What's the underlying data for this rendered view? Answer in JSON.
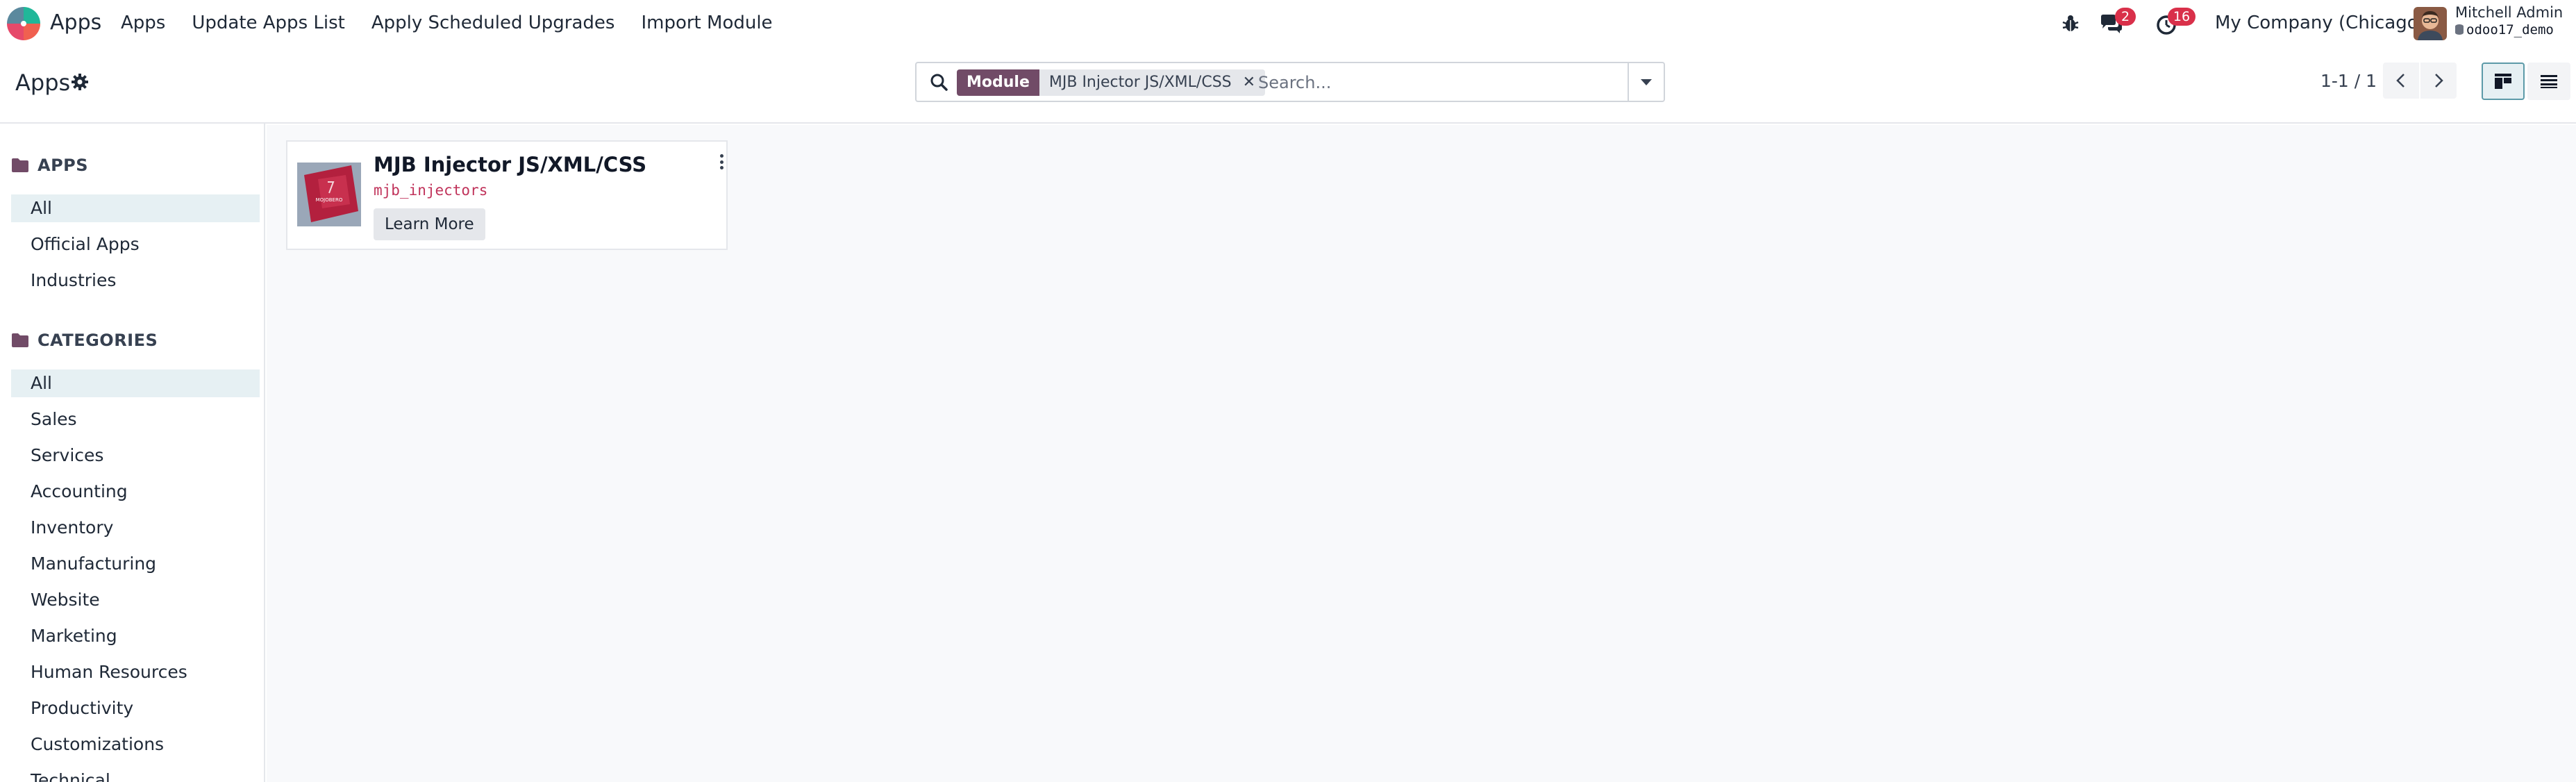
{
  "navbar": {
    "app_name": "Apps",
    "menu": [
      "Apps",
      "Update Apps List",
      "Apply Scheduled Upgrades",
      "Import Module"
    ],
    "messages_count": "2",
    "activities_count": "16",
    "company": "My Company (Chicago)",
    "user_name": "Mitchell Admin",
    "database": "odoo17_demo"
  },
  "control_panel": {
    "title": "Apps",
    "search": {
      "facet_label": "Module",
      "facet_value": "MJB Injector JS/XML/CSS",
      "placeholder": "Search..."
    },
    "pager": "1-1 / 1"
  },
  "sidebar": {
    "apps_section": {
      "title": "APPS",
      "items": [
        "All",
        "Official Apps",
        "Industries"
      ]
    },
    "categories_section": {
      "title": "CATEGORIES",
      "items": [
        "All",
        "Sales",
        "Services",
        "Accounting",
        "Inventory",
        "Manufacturing",
        "Website",
        "Marketing",
        "Human Resources",
        "Productivity",
        "Customizations",
        "Technical"
      ]
    }
  },
  "module_card": {
    "title": "MJB Injector JS/XML/CSS",
    "technical_name": "mjb_injectors",
    "button_label": "Learn More",
    "logo_text": "MOJOBERO"
  },
  "colors": {
    "brand": "#714b67",
    "badge": "#d9304a",
    "active_bg": "#e6f0f3",
    "tech_name": "#c0325a"
  },
  "icons": [
    "app-logo-icon",
    "bug-icon",
    "chat-icon",
    "clock-icon",
    "gear-icon",
    "search-icon",
    "chevron-left-icon",
    "chevron-right-icon",
    "kanban-view-icon",
    "list-view-icon",
    "folder-icon",
    "kebab-menu-icon"
  ]
}
